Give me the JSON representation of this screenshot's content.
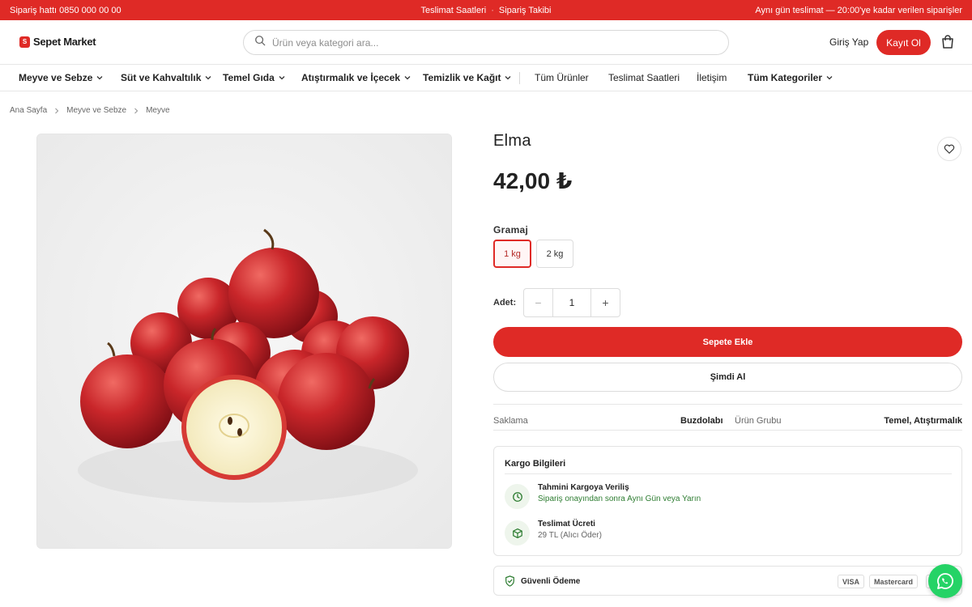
{
  "topbar": {
    "hotline": "Sipariş hattı 0850 000 00 00",
    "links": [
      "Teslimat Saatleri",
      "Sipariş Takibi"
    ],
    "separator": "·",
    "notice": "Aynı gün teslimat — 20:00'ye kadar verilen siparişler"
  },
  "header": {
    "logo_mark": "S",
    "logo_text": "Sepet Market",
    "search_placeholder": "Ürün veya kategori ara...",
    "login_label": "Giriş Yap",
    "register_label": "Kayıt Ol"
  },
  "nav": {
    "categories": [
      {
        "label": "Meyve ve Sebze"
      },
      {
        "label": "Süt ve Kahvaltılık"
      },
      {
        "label": "Temel Gıda"
      },
      {
        "label": "Atıştırmalık ve İçecek"
      },
      {
        "label": "Temizlik ve Kağıt"
      }
    ],
    "links": [
      "Tüm Ürünler",
      "Teslimat Saatleri",
      "İletişim"
    ],
    "all_categories": "Tüm Kategoriler"
  },
  "breadcrumb": [
    "Ana Sayfa",
    "Meyve ve Sebze",
    "Meyve"
  ],
  "product": {
    "title": "Elma",
    "price": "42,00 ₺",
    "gram_label": "Gramaj",
    "options": [
      "1 kg",
      "2 kg"
    ],
    "selected_option": "1 kg",
    "quantity_label": "Adet:",
    "quantity": "1",
    "minus": "−",
    "plus": "+",
    "add_to_cart": "Sepete Ekle",
    "buy_now": "Şimdi Al",
    "specs": [
      {
        "key": "Saklama",
        "value": "Buzdolabı"
      },
      {
        "key": "Ürün Grubu",
        "value": "Temel, Atıştırmalık"
      }
    ]
  },
  "cargo": {
    "title": "Kargo Bilgileri",
    "items": [
      {
        "title": "Tahmini Kargoya Veriliş",
        "sub": "Sipariş onayından sonra Aynı Gün veya Yarın"
      },
      {
        "title": "Teslimat Ücreti",
        "sub": "29 TL (Alıcı Öder)"
      }
    ]
  },
  "payment": {
    "label": "Güvenli Ödeme",
    "badges": [
      "VISA",
      "Mastercard"
    ]
  },
  "colors": {
    "brand": "#df2a26",
    "success": "#2e7d32",
    "whatsapp": "#25d366"
  },
  "icons": [
    "search-icon",
    "cart-icon",
    "chevron-down-icon",
    "heart-icon",
    "clock-icon",
    "box-icon",
    "shield-check-icon",
    "whatsapp-icon"
  ]
}
